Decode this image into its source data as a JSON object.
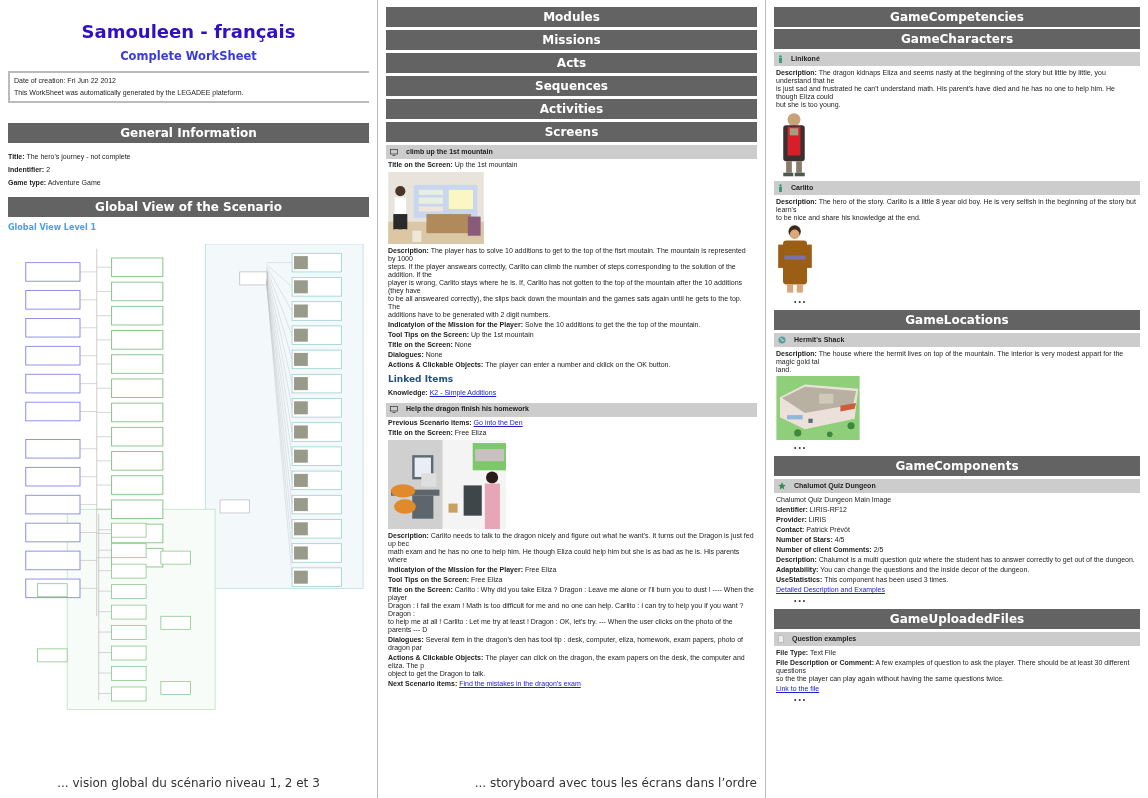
{
  "left": {
    "title": "Samouleen - français",
    "subtitle": "Complete WorkSheet",
    "info_box": [
      "Date of creation: Fri Jun 22 2012",
      "This WorkSheet was automatically generated by the LEGADEE plateform."
    ],
    "general": {
      "heading": "General Information",
      "fields": [
        {
          "label": "Title:",
          "value": "The hero's journey - not complete"
        },
        {
          "label": "Indentifier:",
          "value": "2"
        },
        {
          "label": "Game type:",
          "value": "Adventure Game"
        }
      ]
    },
    "global_view": {
      "heading": "Global View of the Scenario",
      "level_label": "Global View Level 1"
    },
    "caption": "... vision global du scénario niveau 1, 2 et 3"
  },
  "middle": {
    "sections": [
      "Modules",
      "Missions",
      "Acts",
      "Sequences",
      "Activities",
      "Screens"
    ],
    "screens": [
      {
        "title": "climb up the 1st mountain",
        "rows": [
          {
            "kind": "field",
            "label": "Title on the Screen:",
            "lines": [
              "Up the 1st mountain"
            ]
          },
          {
            "kind": "picture"
          },
          {
            "kind": "field",
            "label": "Description:",
            "lines": [
              "The player has to solve 10 additions to get to the top of the fisrt moutain. The mountain is represented by 1000",
              "steps. If the player answears correctly, Carlito can climb the number of steps corresponding to the solution of the addition. If the",
              "player is wrong, Carlito stays where he is. If, Carlito has not gotten to the top of the mountain after the 10 additions (they have",
              "to be all answeared correctly), the slips back down the mountain and the games sats again until he gets to the top. The",
              "additions have to be generated with 2 digit numbers."
            ]
          },
          {
            "kind": "field",
            "label": "Indicatyion of the Mission for the Player:",
            "lines": [
              "Solve the 10 additions to get the the top of the mountain."
            ]
          },
          {
            "kind": "field",
            "label": "Tool Tips on the Screen:",
            "lines": [
              "Up the 1st mountain"
            ]
          },
          {
            "kind": "field",
            "label": "Title on the Screen:",
            "lines": [
              "None"
            ]
          },
          {
            "kind": "field",
            "label": "Dialogues:",
            "lines": [
              "None"
            ]
          },
          {
            "kind": "field",
            "label": "Actions & Clickable Objects:",
            "lines": [
              "The player can enter a number and cklick on the OK button."
            ]
          },
          {
            "kind": "heading",
            "text": "Linked Items"
          },
          {
            "kind": "link",
            "label": "Knowledge:",
            "text": "K2 - Simple Additions"
          }
        ]
      },
      {
        "title": "Help the dragon finish his homework",
        "rows": [
          {
            "kind": "link",
            "label": "Previous Scenario items:",
            "text": "Go into the Den"
          },
          {
            "kind": "field",
            "label": "Title on the Screen:",
            "lines": [
              "Free Eliza"
            ]
          },
          {
            "kind": "picture"
          },
          {
            "kind": "field",
            "label": "Description:",
            "lines": [
              "Carlito needs to talk to the dragon nicely and figure out what he want's. It turns out the Dragon is just fed up bec",
              "math exam and he has no one to help him. He though Eliza could help him but she is as bad as he is. His parents where"
            ]
          },
          {
            "kind": "field",
            "label": "Indicatyion of the Mission for the Player:",
            "lines": [
              "Free Eliza"
            ]
          },
          {
            "kind": "field",
            "label": "Tool Tips on the Screen:",
            "lines": [
              "Free Eliza"
            ]
          },
          {
            "kind": "field",
            "label": "Title on the Screen:",
            "lines": [
              "Carlito : Why did you take Eliza ? Dragon : Leave me alone or I'll burn you to dust ! ---- When the player",
              "Dragon : I fail the exam ! Math is too difficult for me and no one can help. Carlito : I can try to help you if you want ? Dragon :",
              "to help me at all ! Carlito : Let me try at least ! Dragon : OK, let's try. --- When the user clicks on the photo of the parents --- D"
            ]
          },
          {
            "kind": "field",
            "label": "Dialogues:",
            "lines": [
              "Several item in the dragon's den has tool tip : desk, computer, eliza, homework, exam papers, photo of dragon par"
            ]
          },
          {
            "kind": "field",
            "label": "Actions & Clickable Objects:",
            "lines": [
              "The player can click on the dragon, the exam papers on the desk, the computer and eliza. The p",
              "object to get the Dragon to talk."
            ]
          },
          {
            "kind": "link",
            "label": "Next Scenario items:",
            "text": "Find the mistakes in the dragon's exam"
          }
        ]
      }
    ],
    "caption": "... storyboard avec tous les écrans dans l’ordre"
  },
  "right": {
    "sections": [
      {
        "heading": "GameCompetencies"
      },
      {
        "heading": "GameCharacters",
        "kind": "characters",
        "items": [
          {
            "title": "Linikoné",
            "rows": [
              {
                "kind": "field",
                "label": "Description:",
                "lines": [
                  "The dragon kidnaps Eliza and seems nasty at the beginning of the story but little by little, you understand that he",
                  "is just sad and frustrated he can't understand math. His parent's have died and he has no one to help him. He though Eliza could",
                  "but she is too young."
                ]
              },
              {
                "kind": "picture"
              }
            ]
          },
          {
            "title": "Carlito",
            "rows": [
              {
                "kind": "field",
                "label": "Description:",
                "lines": [
                  "The hero of the story. Carlito is a little 8 year old boy. He is very selfish in the beginning of the story but learn's",
                  "to be nice and share his knowledge at the end."
                ]
              },
              {
                "kind": "picture"
              }
            ]
          }
        ],
        "more": "• • •"
      },
      {
        "heading": "GameLocations",
        "kind": "locations",
        "items": [
          {
            "title": "Hermit's Shack",
            "rows": [
              {
                "kind": "field",
                "label": "Description:",
                "lines": [
                  "The house where the hermit lives on top of the mountain. The interior is very modest appart for the magic gold tal",
                  "land."
                ]
              },
              {
                "kind": "picture"
              }
            ]
          }
        ],
        "more": "• • •"
      },
      {
        "heading": "GameComponents",
        "kind": "components",
        "items": [
          {
            "title": "Chalumot Quiz Dungeon",
            "rows": [
              {
                "kind": "text",
                "text": "Chalumot Quiz Dungeon Main Image"
              },
              {
                "kind": "field",
                "label": "Identifier:",
                "lines": [
                  "LIRIS-RF12"
                ]
              },
              {
                "kind": "field",
                "label": "Provider:",
                "lines": [
                  "LIRIS"
                ]
              },
              {
                "kind": "field",
                "label": "Contact:",
                "lines": [
                  "Patrick Prévôt"
                ]
              },
              {
                "kind": "field",
                "label": "Number of Stars:",
                "lines": [
                  "4/5"
                ]
              },
              {
                "kind": "field",
                "label": "Number of client Comments:",
                "lines": [
                  "2/5"
                ]
              },
              {
                "kind": "field",
                "label": "Description:",
                "lines": [
                  "Chalumot is a multi question quiz where the student has to answer correctly to get out of the dungeon."
                ]
              },
              {
                "kind": "field",
                "label": "Adaptability:",
                "lines": [
                  "You can change the questions and the inside decor of the dungeon."
                ]
              },
              {
                "kind": "field",
                "label": "UseStatistics:",
                "lines": [
                  "This component has been used 3 times."
                ]
              },
              {
                "kind": "link",
                "text": "Detailed Description and Examples"
              }
            ]
          }
        ],
        "more": "• • •"
      },
      {
        "heading": "GameUploadedFiles",
        "kind": "files",
        "items": [
          {
            "title": "Question examples",
            "rows": [
              {
                "kind": "field",
                "label": "File Type:",
                "lines": [
                  "Text File"
                ]
              },
              {
                "kind": "field",
                "label": "File Description or Comment:",
                "lines": [
                  "A few examples of question to ask the player. There should be at least 30 different questions",
                  "so the the player can play again without having the same questions twice."
                ]
              },
              {
                "kind": "link",
                "text": "Link to the file"
              }
            ]
          }
        ],
        "more": "• • •"
      }
    ]
  }
}
